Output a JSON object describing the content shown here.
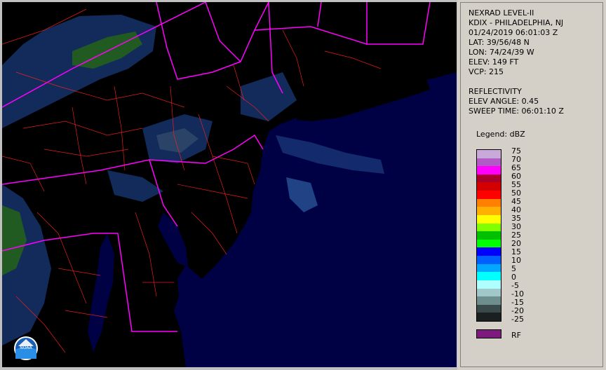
{
  "header": {
    "product": "NEXRAD LEVEL-II",
    "station": "KDIX - PHILADELPHIA, NJ",
    "datetime": "01/24/2019 06:01:03 Z",
    "lat": "LAT: 39/56/48 N",
    "lon": "LON: 74/24/39 W",
    "elev": "ELEV: 149 FT",
    "vcp": "VCP: 215"
  },
  "product_info": {
    "type": "REFLECTIVITY",
    "elev_angle": "ELEV ANGLE: 0.45",
    "sweep_time": "SWEEP TIME: 06:01:10 Z"
  },
  "legend": {
    "title": "Legend: dBZ",
    "labels": [
      "75",
      "70",
      "65",
      "60",
      "55",
      "50",
      "45",
      "40",
      "35",
      "30",
      "25",
      "20",
      "15",
      "10",
      "5",
      "0",
      "-5",
      "-10",
      "-15",
      "-20",
      "-25"
    ],
    "colors": [
      "#c9a9d9",
      "#b05cc4",
      "#ff00ff",
      "#a8002a",
      "#d40000",
      "#ff0000",
      "#ff8000",
      "#ffb000",
      "#ffff00",
      "#7fff00",
      "#00c000",
      "#00ff00",
      "#0000ff",
      "#0060ff",
      "#00a8ff",
      "#00ffff",
      "#b0ffff",
      "#a0c8c8",
      "#6e8e8e",
      "#3a4a4a",
      "#1a2020"
    ],
    "rf_label": "RF",
    "rf_color": "#7d1a7d"
  },
  "map": {
    "land_color": "#000000",
    "ocean_color": "#000044",
    "state_border_color": "#ff00ff",
    "county_color": "#ff2020",
    "logo": "noaa-logo"
  }
}
